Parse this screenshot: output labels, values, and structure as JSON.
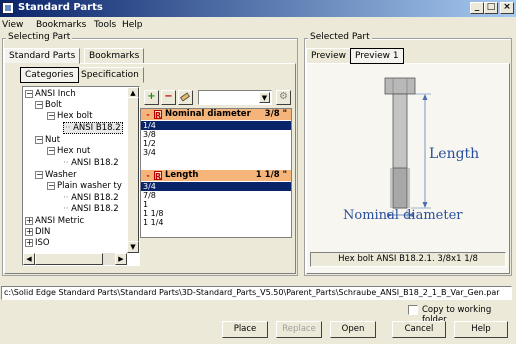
{
  "window": {
    "title": "Standard Parts",
    "min": "_",
    "max": "□",
    "close": "×"
  },
  "menu": [
    "View",
    "Bookmarks",
    "Tools",
    "Help"
  ],
  "selecting": {
    "legend": "Selecting Part",
    "tabs": [
      "Standard Parts",
      "Bookmarks"
    ],
    "subtabs": [
      "Categories",
      "Specification"
    ],
    "tree": [
      {
        "label": "ANSI Inch",
        "exp": "−"
      },
      {
        "label": "Bolt",
        "exp": "−"
      },
      {
        "label": "Hex bolt",
        "exp": "−"
      },
      {
        "label": "ANSI B18.2",
        "exp": ""
      },
      {
        "label": "Nut",
        "exp": "−"
      },
      {
        "label": "Hex nut",
        "exp": "−"
      },
      {
        "label": "ANSI B18.2",
        "exp": ""
      },
      {
        "label": "Washer",
        "exp": "−"
      },
      {
        "label": "Plain washer ty",
        "exp": "−"
      },
      {
        "label": "ANSI B18.2",
        "exp": ""
      },
      {
        "label": "ANSI B18.2",
        "exp": ""
      },
      {
        "label": "ANSI Metric",
        "exp": "+"
      },
      {
        "label": "DIN",
        "exp": "+"
      },
      {
        "label": "ISO",
        "exp": "+"
      }
    ],
    "params": [
      {
        "name": "Nominal diameter",
        "value": "3/8  \"",
        "minus": "-",
        "r": "R",
        "options": [
          "1/4",
          "3/8",
          "1/2",
          "3/4"
        ],
        "selected": 0
      },
      {
        "name": "Length",
        "value": "1 1/8  \"",
        "minus": "-",
        "r": "R",
        "options": [
          "3/4",
          "7/8",
          "1",
          "1 1/8",
          "1 1/4"
        ],
        "selected": 0
      }
    ]
  },
  "selected": {
    "legend": "Selected Part",
    "tabs": [
      "Preview",
      "Preview 1"
    ],
    "labels": {
      "length": "Length",
      "diameter": "Nominal diameter"
    },
    "caption": "Hex bolt ANSI B18.2.1. 3/8x1 1/8"
  },
  "path": "c:\\Solid Edge Standard Parts\\Standard Parts\\3D-Standard_Parts_V5.50\\Parent_Parts\\Schraube_ANSI_B18_2_1_B_Var_Gen.par",
  "copy_label": "Copy to working folder",
  "buttons": {
    "place": "Place",
    "replace": "Replace",
    "open": "Open",
    "cancel": "Cancel",
    "help": "Help"
  },
  "colors": {
    "titlebar": "#0a246a",
    "header": "#f5b57a",
    "selection": "#0a246a",
    "dimension": "#4a6fb0"
  }
}
